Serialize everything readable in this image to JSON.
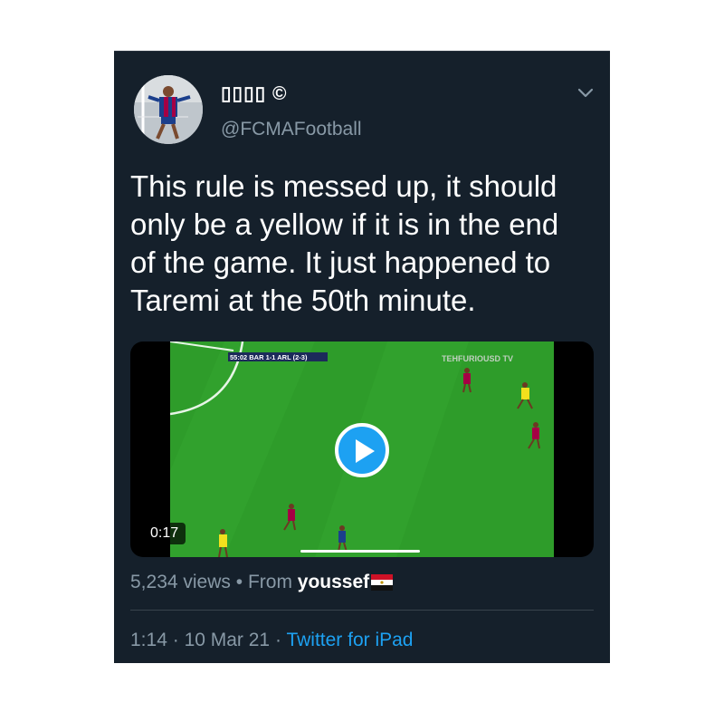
{
  "author": {
    "display_name": "▯▯▯▯ ©",
    "handle": "@FCMAFootball"
  },
  "tweet": {
    "text": "This rule is messed up, it should only be a yellow if it is in the end of the game. It just happened to Taremi at the 50th minute."
  },
  "video": {
    "duration": "0:17",
    "scoreboard": "55:02 BAR 1-1 ARL (2-3)",
    "watermark": "TEHFURIOUSD TV",
    "progress": 0.35
  },
  "stats": {
    "views": "5,234 views",
    "separator": "•",
    "from_label": "From",
    "from_user": "youssef"
  },
  "meta": {
    "time": "1:14",
    "date": "10 Mar 21",
    "dot": "·",
    "source": "Twitter for iPad"
  },
  "colors": {
    "background": "#15202b",
    "accent": "#1da1f2",
    "secondary_text": "#8899a6",
    "pitch": "#2e9c2a"
  },
  "icons": [
    "avatar",
    "chevron-down-icon",
    "play-icon",
    "egypt-flag-icon"
  ]
}
